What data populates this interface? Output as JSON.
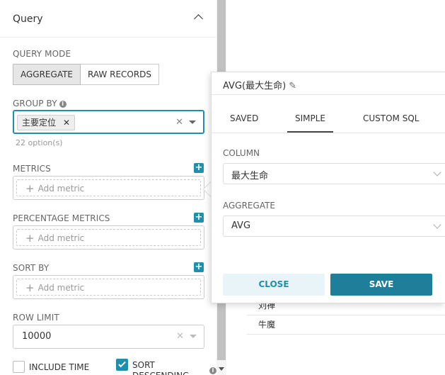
{
  "panel": {
    "title": "Query",
    "query_mode_label": "QUERY MODE",
    "modes": [
      "AGGREGATE",
      "RAW RECORDS"
    ],
    "group_by_label": "GROUP BY",
    "group_by_tag": "主要定位",
    "group_by_hint": "22 option(s)",
    "metrics_label": "METRICS",
    "percentage_metrics_label": "PERCENTAGE METRICS",
    "sort_by_label": "SORT BY",
    "add_metric": "Add metric",
    "row_limit_label": "ROW LIMIT",
    "row_limit_value": "10000",
    "include_time_label": "INCLUDE TIME",
    "sort_descending_label": "SORT DESCENDING"
  },
  "table": {
    "rows": [
      "刘禅",
      "牛魔"
    ]
  },
  "popover": {
    "title": "AVG(最大生命)",
    "tabs": [
      "SAVED",
      "SIMPLE",
      "CUSTOM SQL"
    ],
    "active_tab": "SIMPLE",
    "column_label": "COLUMN",
    "column_value": "最大生命",
    "aggregate_label": "AGGREGATE",
    "aggregate_value": "AVG",
    "close_label": "CLOSE",
    "save_label": "SAVE"
  },
  "colors": {
    "accent": "#1f8fab",
    "save_button": "#1f7f9b",
    "close_button_bg": "#e9f4f8"
  }
}
